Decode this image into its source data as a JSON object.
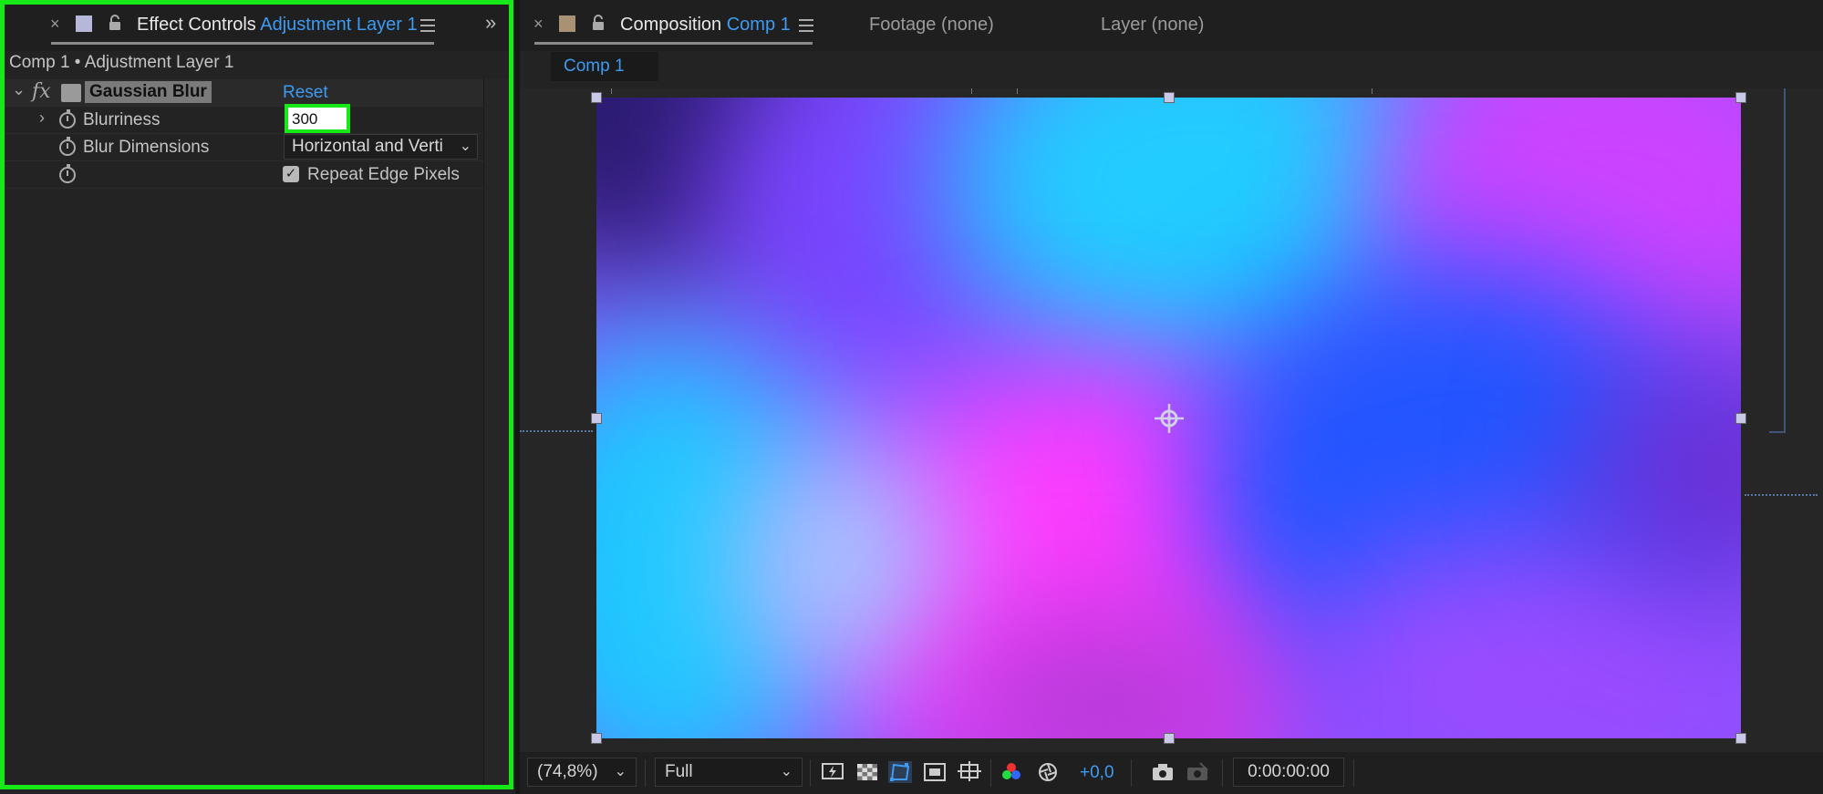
{
  "effect_controls": {
    "close_glyph": "×",
    "tab_title": "Effect Controls",
    "tab_layer": "Adjustment Layer 1",
    "expand_glyph": "»",
    "path": "Comp 1 • Adjustment Layer 1",
    "effect": {
      "name": "Gaussian Blur",
      "fx_label": "fx",
      "reset_label": "Reset",
      "properties": {
        "blurriness": {
          "label": "Blurriness",
          "value": "300"
        },
        "blur_dimensions": {
          "label": "Blur Dimensions",
          "value": "Horizontal and Verti"
        },
        "repeat_edge": {
          "label": "Repeat Edge Pixels",
          "checked": true
        }
      }
    },
    "highlight_color": "#17e817"
  },
  "composition": {
    "close_glyph": "×",
    "tab_title": "Composition",
    "tab_comp": "Comp 1",
    "footage_tab": "Footage (none)",
    "layer_tab": "Layer (none)",
    "subtab": "Comp 1",
    "footer": {
      "zoom": "(74,8%)",
      "resolution": "Full",
      "exposure": "+0,0",
      "timecode": "0:00:00:00"
    }
  },
  "colors": {
    "accent_blue": "#3d9bf2",
    "panel_bg": "#232323"
  },
  "icons": {
    "chevron": "⌄",
    "twirl_open": "⌄",
    "twirl_closed": "›",
    "check": "✓"
  }
}
